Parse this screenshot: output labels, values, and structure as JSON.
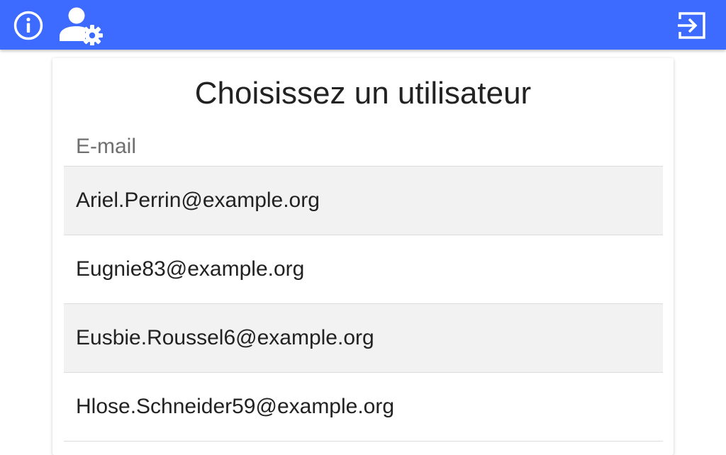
{
  "topbar": {
    "color": "#3d6bff",
    "icons": [
      "info-icon",
      "user-settings-icon",
      "logout-icon"
    ]
  },
  "card": {
    "title": "Choisissez un utilisateur",
    "column_header": "E-mail",
    "users": [
      {
        "email": "Ariel.Perrin@example.org"
      },
      {
        "email": "Eugnie83@example.org"
      },
      {
        "email": "Eusbie.Roussel6@example.org"
      },
      {
        "email": "Hlose.Schneider59@example.org"
      }
    ]
  }
}
